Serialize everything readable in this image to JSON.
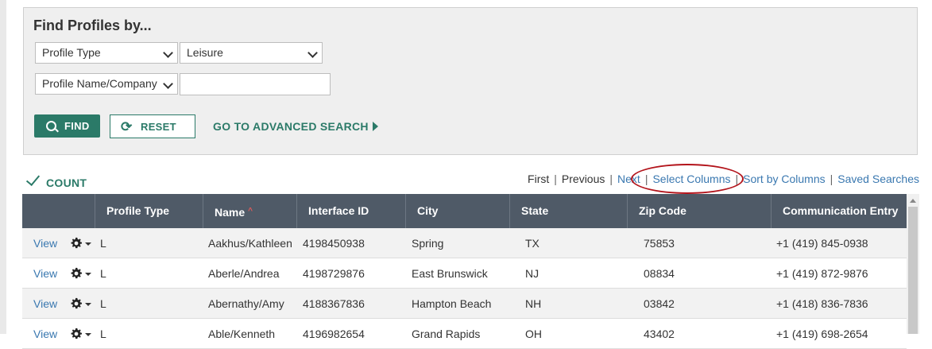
{
  "search": {
    "title": "Find Profiles by...",
    "row1": {
      "field": "Profile Type",
      "value": "Leisure"
    },
    "row2": {
      "field": "Profile Name/Company",
      "value": ""
    },
    "find_label": "FIND",
    "reset_label": "RESET",
    "advanced_label": "GO TO ADVANCED SEARCH"
  },
  "results": {
    "count_label": "COUNT",
    "nav": {
      "first": "First",
      "previous": "Previous",
      "next": "Next",
      "select_columns": "Select Columns",
      "sort_by_columns": "Sort by Columns",
      "saved_searches": "Saved Searches"
    },
    "columns": [
      "Profile Type",
      "Name",
      "Interface ID",
      "City",
      "State",
      "Zip Code",
      "Communication Entry"
    ],
    "sort_indicator": "^",
    "view_label": "View",
    "rows": [
      [
        "L",
        "Aakhus/Kathleen",
        "4198450938",
        "Spring",
        "TX",
        "75853",
        "+1 (419) 845-0938"
      ],
      [
        "L",
        "Aberle/Andrea",
        "4198729876",
        "East Brunswick",
        "NJ",
        "08834",
        "+1 (419) 872-9876"
      ],
      [
        "L",
        "Abernathy/Amy",
        "4188367836",
        "Hampton Beach",
        "NH",
        "03842",
        "+1 (418) 836-7836"
      ],
      [
        "L",
        "Able/Kenneth",
        "4196982654",
        "Grand Rapids",
        "OH",
        "43402",
        "+1 (419) 698-2654"
      ]
    ]
  },
  "colors": {
    "accent": "#2b7a68",
    "link": "#3a78b0",
    "header_bg": "#4f5a67",
    "highlight_oval": "#b3141b"
  },
  "icons": {
    "find": "search-icon",
    "reset": "refresh-icon",
    "count": "check-icon",
    "row_actions": "gear-icon"
  }
}
